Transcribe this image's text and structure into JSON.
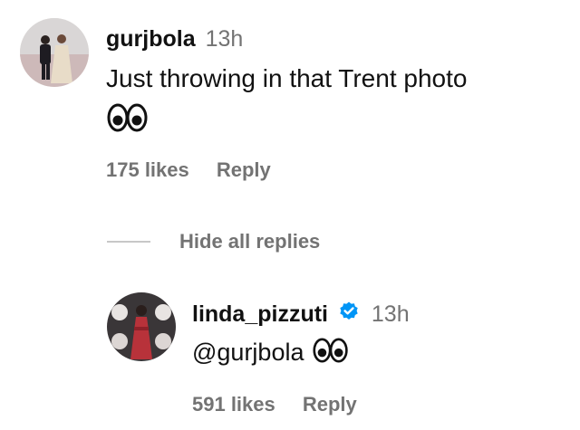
{
  "comment": {
    "username": "gurjbola",
    "time": "13h",
    "text": "Just throwing in that Trent photo",
    "emoji_icon": "eyes-icon",
    "likes": "175 likes",
    "reply_label": "Reply"
  },
  "replies_toggle": {
    "label": "Hide all replies"
  },
  "reply": {
    "username": "linda_pizzuti",
    "verified_icon": "verified-badge-icon",
    "time": "13h",
    "text": "@gurjbola",
    "emoji_icon": "eyes-icon",
    "likes": "591 likes",
    "reply_label": "Reply"
  },
  "colors": {
    "text": "#111111",
    "muted": "#737373",
    "verified": "#0095f6"
  }
}
